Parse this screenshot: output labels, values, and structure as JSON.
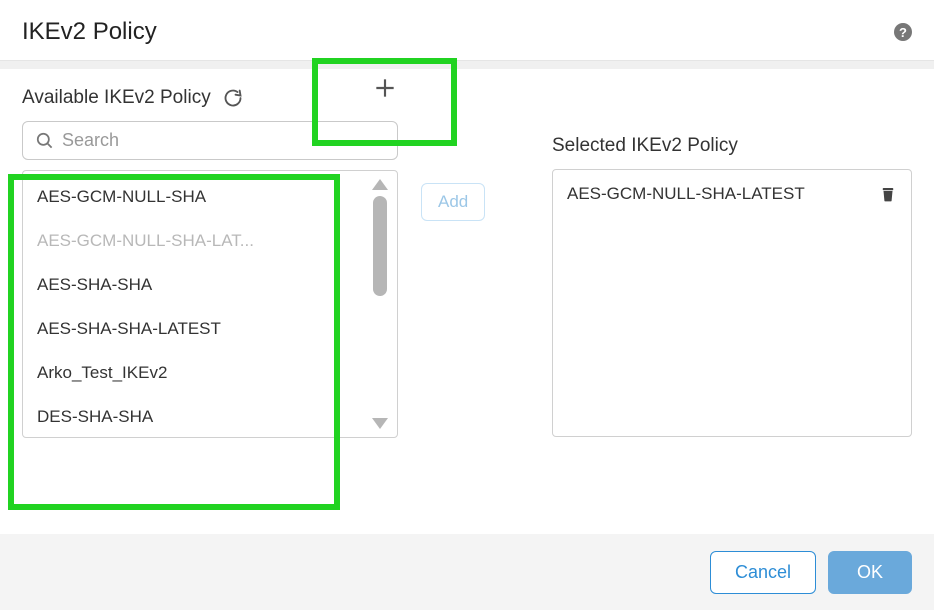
{
  "header": {
    "title": "IKEv2 Policy"
  },
  "available": {
    "label": "Available IKEv2 Policy",
    "search_placeholder": "Search",
    "items": [
      {
        "label": "AES-GCM-NULL-SHA",
        "disabled": false
      },
      {
        "label": "AES-GCM-NULL-SHA-LAT...",
        "disabled": true
      },
      {
        "label": "AES-SHA-SHA",
        "disabled": false
      },
      {
        "label": "AES-SHA-SHA-LATEST",
        "disabled": false
      },
      {
        "label": "Arko_Test_IKEv2",
        "disabled": false
      },
      {
        "label": "DES-SHA-SHA",
        "disabled": false
      }
    ]
  },
  "add_btn": "Add",
  "selected": {
    "label": "Selected IKEv2 Policy",
    "items": [
      {
        "label": "AES-GCM-NULL-SHA-LATEST"
      }
    ]
  },
  "footer": {
    "cancel": "Cancel",
    "ok": "OK"
  }
}
